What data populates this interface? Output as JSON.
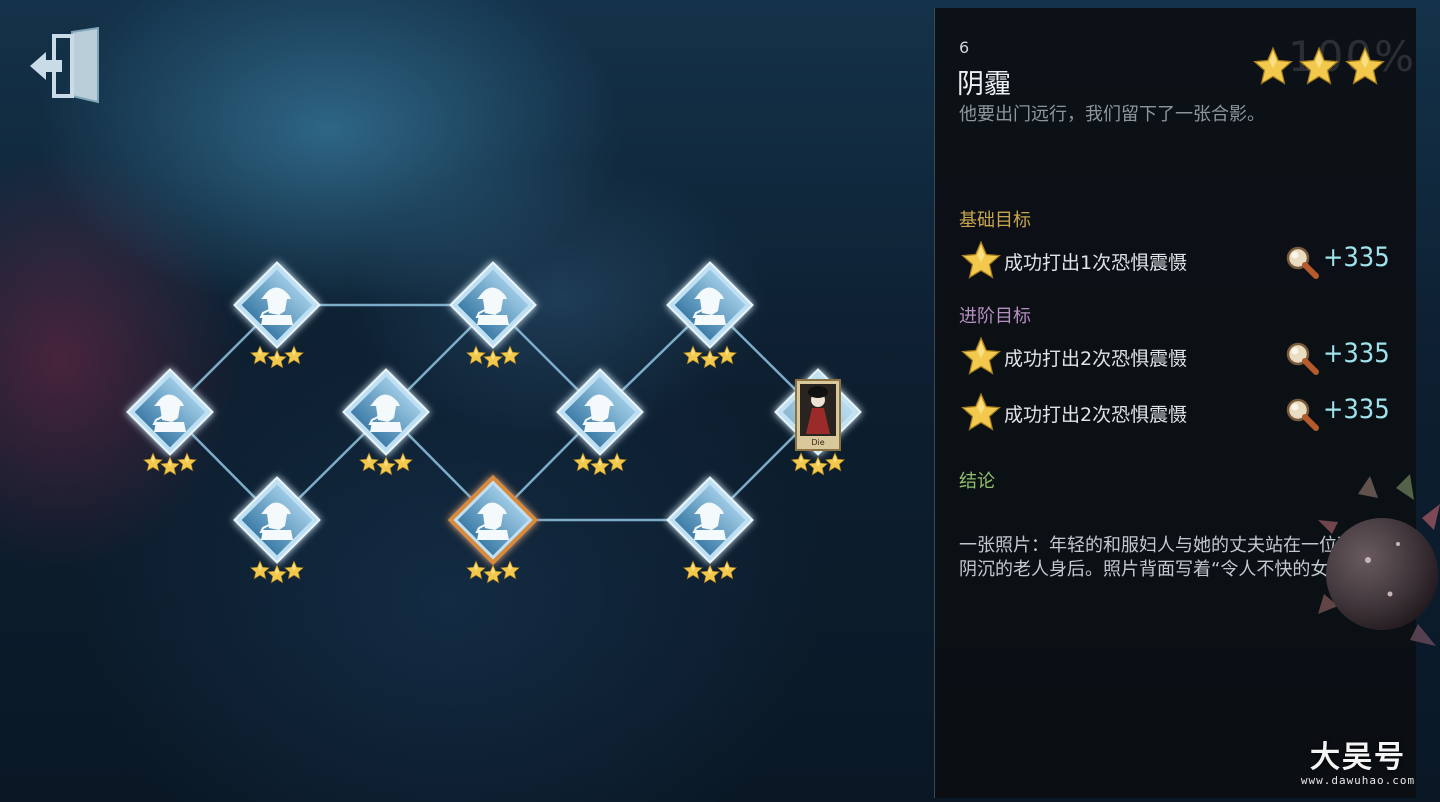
{
  "header": {
    "exit_button_icon": "exit-door-icon"
  },
  "chapter": {
    "number": "6",
    "title": "阴霾",
    "description": "他要出门远行，我们留下了一张合影。",
    "progress_watermark": "100%",
    "stars_earned": 3,
    "stars_total": 3
  },
  "goals": {
    "basic_label": "基础目标",
    "basic": [
      {
        "text": "成功打出1次恐惧震慑",
        "reward": "+335",
        "icon": "magnifier-icon"
      }
    ],
    "advanced_label": "进阶目标",
    "advanced": [
      {
        "text": "成功打出2次恐惧震慑",
        "reward": "+335",
        "icon": "magnifier-icon"
      },
      {
        "text": "成功打出2次恐惧震慑",
        "reward": "+335",
        "icon": "magnifier-icon"
      }
    ]
  },
  "conclusion": {
    "label": "结论",
    "text": "一张照片：年轻的和服妇人与她的丈夫站在一位面色阴沉的老人身后。照片背面写着“令人不快的女人”。"
  },
  "map": {
    "nodes": [
      {
        "id": "n1",
        "stars": 3,
        "type": "detective",
        "selected": false
      },
      {
        "id": "n2",
        "stars": 3,
        "type": "detective",
        "selected": false
      },
      {
        "id": "n3",
        "stars": 3,
        "type": "detective",
        "selected": false
      },
      {
        "id": "n4",
        "stars": 3,
        "type": "detective",
        "selected": false
      },
      {
        "id": "n5",
        "stars": 3,
        "type": "detective",
        "selected": false
      },
      {
        "id": "n6",
        "stars": 3,
        "type": "detective",
        "selected": true
      },
      {
        "id": "n7",
        "stars": 3,
        "type": "detective",
        "selected": false
      },
      {
        "id": "n8",
        "stars": 3,
        "type": "detective",
        "selected": false
      },
      {
        "id": "n9",
        "stars": 3,
        "type": "detective",
        "selected": false
      },
      {
        "id": "n10",
        "stars": 3,
        "type": "detective",
        "selected": false
      },
      {
        "id": "n11",
        "stars": 3,
        "type": "character-portrait",
        "selected": false,
        "portrait_caption": "Die"
      }
    ],
    "edges": [
      [
        "n1",
        "n2"
      ],
      [
        "n1",
        "n3"
      ],
      [
        "n2",
        "n5"
      ],
      [
        "n3",
        "n4"
      ],
      [
        "n4",
        "n5"
      ],
      [
        "n4",
        "n6"
      ],
      [
        "n5",
        "n7"
      ],
      [
        "n6",
        "n7"
      ],
      [
        "n6",
        "n10"
      ],
      [
        "n7",
        "n8"
      ],
      [
        "n8",
        "n9"
      ],
      [
        "n9",
        "n11"
      ],
      [
        "n10",
        "n11"
      ]
    ]
  },
  "watermark": {
    "main": "大吴号",
    "sub": "www.dawuhao.com"
  },
  "colors": {
    "star_gold": "#f2c94c",
    "reward_cyan": "#9ee3ec",
    "basic_label": "#c9a64d",
    "advanced_label": "#b58fc0",
    "conclusion_label": "#8fbf6b",
    "node_fill": "#6fa9cf",
    "selected_border": "#d98a3a"
  }
}
